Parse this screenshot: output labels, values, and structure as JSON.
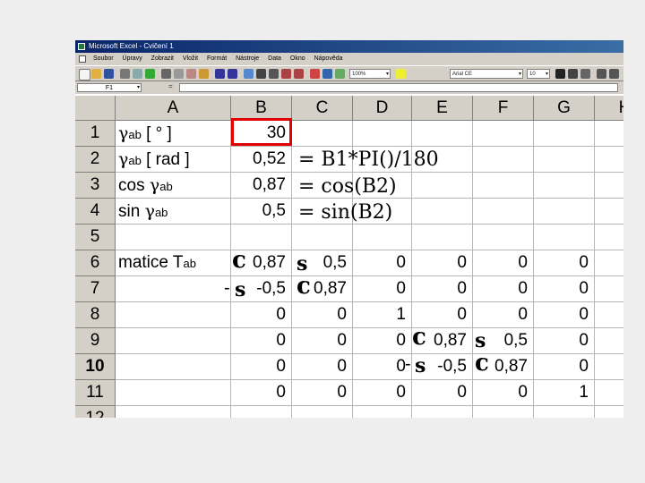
{
  "window": {
    "title": "Microsoft Excel - Cvičení 1",
    "menu": [
      "Soubor",
      "Úpravy",
      "Zobrazit",
      "Vložit",
      "Formát",
      "Nástroje",
      "Data",
      "Okno",
      "Nápověda"
    ],
    "zoom": "100%",
    "font_name": "Arial CE",
    "font_size": "10",
    "name_box": "F1",
    "fx_label": "="
  },
  "grid": {
    "columns": [
      "A",
      "B",
      "C",
      "D",
      "E",
      "F",
      "G",
      "H"
    ],
    "rows": [
      "1",
      "2",
      "3",
      "4",
      "5",
      "6",
      "7",
      "8",
      "9",
      "10",
      "11",
      "12"
    ],
    "a1": {
      "gamma": "γ",
      "sub": "ab",
      "rest": " [ ° ]"
    },
    "a2": {
      "gamma": "γ",
      "sub": "ab",
      "rest": " [ rad ]"
    },
    "a3": {
      "pre": "cos ",
      "gamma": "γ",
      "sub": "ab"
    },
    "a4": {
      "pre": "sin ",
      "gamma": "γ",
      "sub": "ab"
    },
    "a6": {
      "pre": "matice T",
      "sub": "ab"
    },
    "values": {
      "B1": "30",
      "B2": "0,52",
      "B3": "0,87",
      "B4": "0,5",
      "B6": "0,87",
      "C6": "0,5",
      "D6": "0",
      "E6": "0",
      "F6": "0",
      "G6": "0",
      "B7": "-0,5",
      "C7": "0,87",
      "D7": "0",
      "E7": "0",
      "F7": "0",
      "G7": "0",
      "B8": "0",
      "C8": "0",
      "D8": "1",
      "E8": "0",
      "F8": "0",
      "G8": "0",
      "B9": "0",
      "C9": "0",
      "D9": "0",
      "E9": "0,87",
      "F9": "0,5",
      "G9": "0",
      "B10": "0",
      "C10": "0",
      "D10": "0",
      "E10": "-0,5",
      "F10": "0,87",
      "G10": "0",
      "B11": "0",
      "C11": "0",
      "D11": "0",
      "E11": "0",
      "F11": "0",
      "G11": "1"
    }
  },
  "annotations": {
    "f_b2": "= B1*PI()/180",
    "f_b3": "= cos(B2)",
    "f_b4": "= sin(B2)",
    "c": "c",
    "s": "s",
    "minus": "-"
  }
}
